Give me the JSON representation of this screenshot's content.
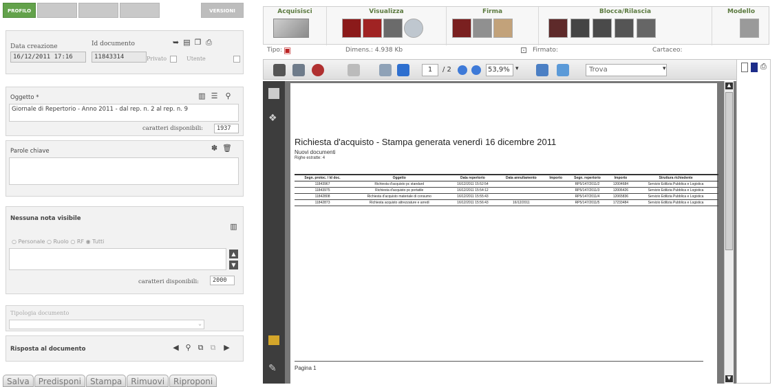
{
  "tabs": {
    "profilo": "PROFILO",
    "versioni": "VERSIONI"
  },
  "profile": {
    "data_creazione_label": "Data creazione",
    "data_creazione_value": "16/12/2011 17:16",
    "id_documento_label": "Id documento",
    "id_documento_value": "11843314",
    "privato_label": "Privato",
    "utente_label": "Utente"
  },
  "oggetto": {
    "label": "Oggetto *",
    "value": "Giornale di Repertorio - Anno 2011 - dal rep. n. 2 al rep. n. 9",
    "chars_label": "caratteri disponibili:",
    "chars_value": "1937"
  },
  "parole_chiave": {
    "label": "Parole chiave"
  },
  "note": {
    "label": "Nessuna nota visibile",
    "radio_options": [
      "Personale",
      "Ruolo",
      "RF",
      "Tutti"
    ],
    "chars_label": "caratteri disponibili:",
    "chars_value": "2000"
  },
  "tipologia": {
    "label": "Tipologia documento"
  },
  "risposta": {
    "label": "Risposta al documento"
  },
  "bottom_buttons": [
    "Salva",
    "Predisponi",
    "Stampa",
    "Rimuovi",
    "Riproponi"
  ],
  "toolbar": {
    "groups": [
      "Acquisisci",
      "Visualizza",
      "Firma",
      "Blocca/Rilascia",
      "Modello"
    ],
    "tipo_label": "Tipo:",
    "dimensione": "Dimens.: 4.938 Kb",
    "firmato_label": "Firmato:",
    "cartaceo_label": "Cartaceo:"
  },
  "pdf_toolbar": {
    "page_current": "1",
    "page_total": "/ 2",
    "zoom": "53,9%",
    "find_placeholder": "Trova"
  },
  "pdf_doc": {
    "title": "Richiesta d'acquisto - Stampa generata venerdì 16 dicembre 2011",
    "subtitle1": "Nuovi documenti",
    "subtitle2": "Righe estratte: 4",
    "columns": [
      "Segn. protoc. / Id doc.",
      "Oggetto",
      "Data repertorio",
      "Data annullamento",
      "Importo",
      "Segn. repertorio",
      "Importo",
      "Struttura richiedente"
    ],
    "rows": [
      [
        "11843967",
        "Richiesta d'acquisto pc standard",
        "16/12/2011 15:52:54",
        "",
        "",
        "RP5/147/2011/2",
        "12004684",
        "Servizio Edilizia Pubblica e Logistica"
      ],
      [
        "11843975",
        "Richiesta d'acquisto pc portatile",
        "16/12/2011 15:54:12",
        "",
        "",
        "RP5/147/2011/3",
        "12006426",
        "Servizio Edilizia Pubblica e Logistica"
      ],
      [
        "11842808",
        "Richiesta d'acquisto materiale di consumo",
        "16/12/2011 15:55:43",
        "",
        "",
        "RP5/147/2011/4",
        "12065836",
        "Servizio Edilizia Pubblica e Logistica"
      ],
      [
        "11842873",
        "Richiesta acquisto attrezzature e arredi",
        "16/12/2011 15:56:43",
        "16/12/2011",
        "",
        "RP5/147/2011/5",
        "17233484",
        "Servizio Edilizia Pubblica e Logistica"
      ]
    ],
    "footer": "Pagina 1"
  }
}
